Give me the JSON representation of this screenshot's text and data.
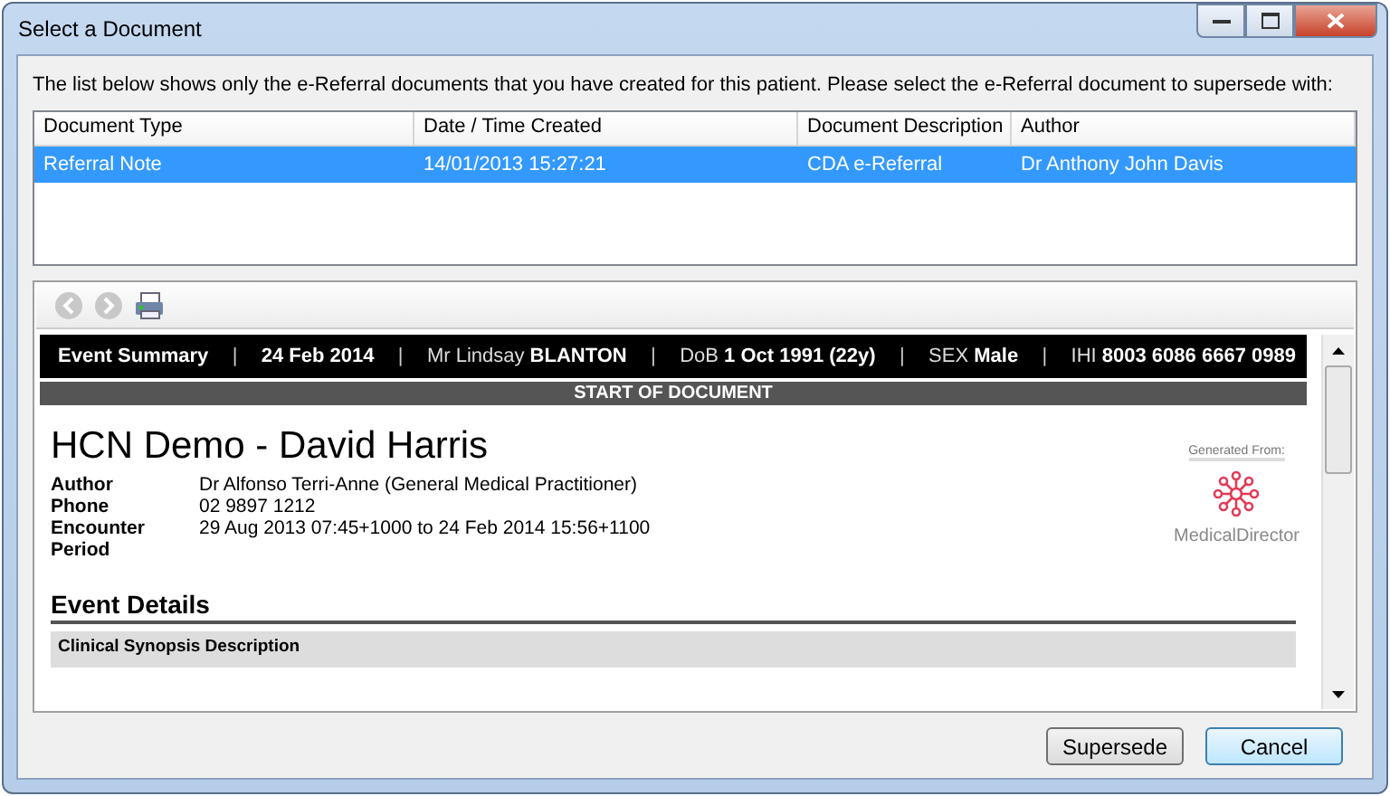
{
  "window": {
    "title": "Select a Document"
  },
  "instruction": "The list below shows only the e-Referral documents that you have created for this patient. Please select the e-Referral document to supersede with:",
  "table": {
    "columns": [
      "Document Type",
      "Date / Time Created",
      "Document Description",
      "Author"
    ],
    "rows": [
      {
        "cells": [
          "Referral Note",
          "14/01/2013 15:27:21",
          "CDA e-Referral",
          "Dr Anthony John Davis"
        ],
        "selected": true
      }
    ]
  },
  "viewer": {
    "toolbar": [
      {
        "kind": "back",
        "disabled": true
      },
      {
        "kind": "forward",
        "disabled": true
      },
      {
        "kind": "print",
        "disabled": false
      }
    ],
    "document": {
      "banner": [
        {
          "kind": "field",
          "text": "**Event Summary**"
        },
        {
          "kind": "sep",
          "text": "|"
        },
        {
          "kind": "field",
          "text": "**24 Feb 2014**"
        },
        {
          "kind": "sep",
          "text": "|"
        },
        {
          "kind": "field",
          "text": "Mr Lindsay **BLANTON**"
        },
        {
          "kind": "sep",
          "text": "|"
        },
        {
          "kind": "field",
          "text": "DoB **1 Oct 1991 (22y)**"
        },
        {
          "kind": "sep",
          "text": "|"
        },
        {
          "kind": "field",
          "text": "SEX **Male**"
        },
        {
          "kind": "sep",
          "text": "|"
        },
        {
          "kind": "field",
          "text": "IHI **8003 6086 6667 0989**"
        }
      ],
      "subbanner": "START OF DOCUMENT",
      "title": "HCN Demo - David Harris",
      "fields": [
        {
          "label": "Author",
          "value": "Dr Alfonso Terri-Anne (General Medical Practitioner)"
        },
        {
          "label": "Phone",
          "value": "02 9897 1212"
        },
        {
          "label": "Encounter Period",
          "value": "29 Aug 2013 07:45+1000 to 24 Feb 2014 15:56+1100"
        }
      ],
      "logo": {
        "caption": "Generated From:",
        "name": "MedicalDirector"
      },
      "section": "Event Details",
      "subsection": "Clinical Synopsis Description"
    }
  },
  "buttons": [
    {
      "label": "Supersede",
      "default": false
    },
    {
      "label": "Cancel",
      "default": true
    }
  ]
}
